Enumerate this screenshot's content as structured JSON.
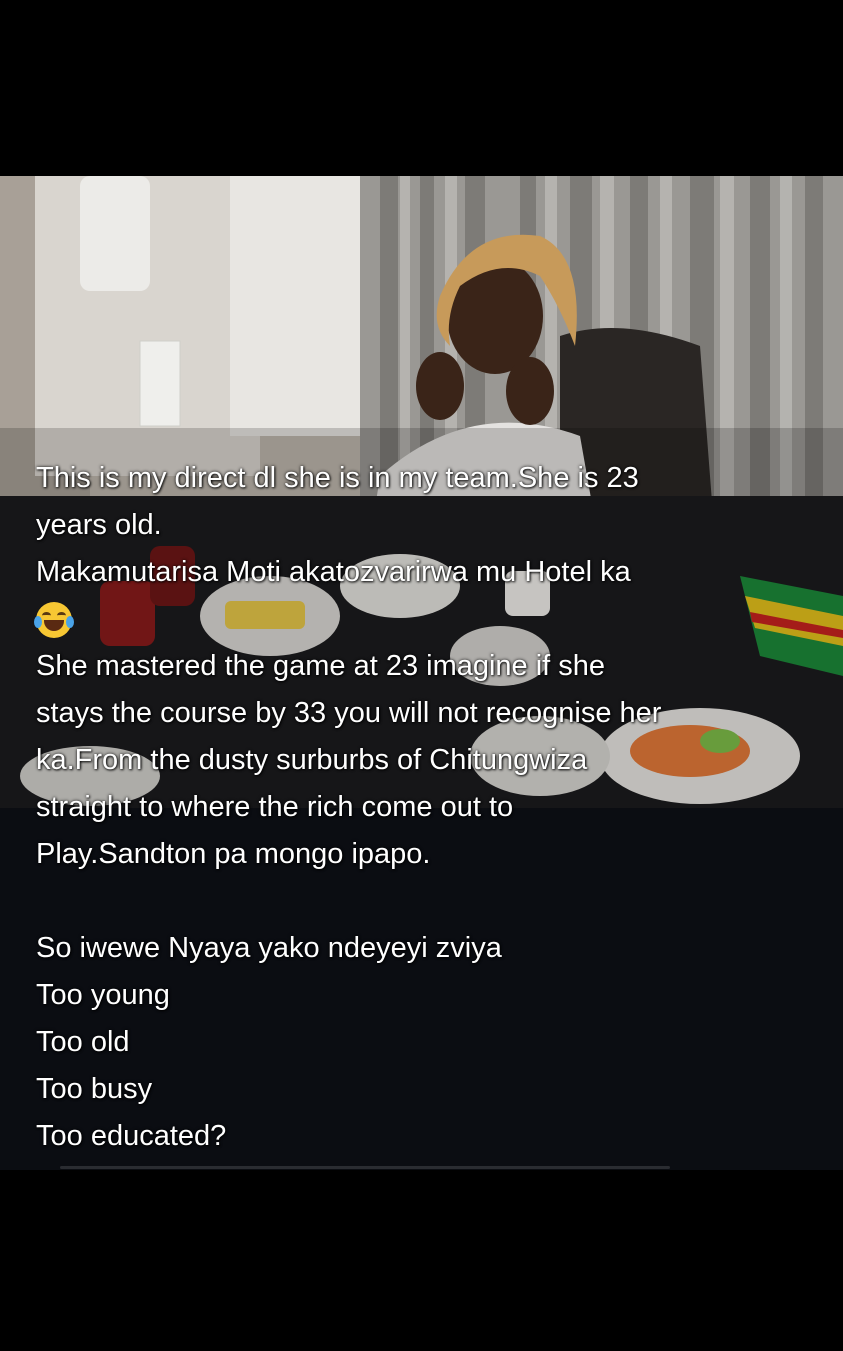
{
  "post": {
    "caption_lines": [
      "This is my direct dl she is in my team.She is 23",
      "years old.",
      "Makamutarisa Moti akatozvarirwa mu Hotel ka",
      "",
      "She mastered the game at 23 imagine if she",
      "stays the course by 33 you will not recognise her",
      "ka.From the dusty surburbs of Chitungwiza",
      "straight to where the rich come out to",
      "Play.Sandton pa mongo ipapo.",
      " ",
      "So iwewe Nyaya yako ndeyeyi zviya",
      "Too young",
      "Too old",
      "Too busy",
      "Too educated?"
    ],
    "emoji_icon": "face-with-tears-of-joy-icon"
  },
  "colors": {
    "background": "#000000",
    "panel": "#0b0d12",
    "text": "#ffffff"
  }
}
